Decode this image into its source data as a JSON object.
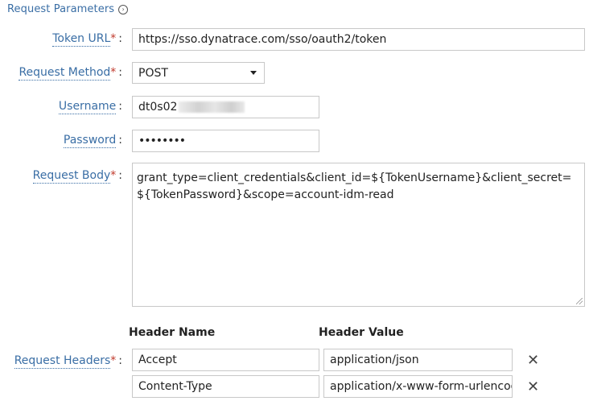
{
  "section": {
    "title": "Request Parameters",
    "info_icon": "info-circle-icon"
  },
  "token_url": {
    "label": "Token URL",
    "value": "https://sso.dynatrace.com/sso/oauth2/token"
  },
  "request_method": {
    "label": "Request Method",
    "value": "POST",
    "icon": "chevron-down-icon"
  },
  "username": {
    "label": "Username",
    "value": "dt0s02"
  },
  "password": {
    "label": "Password",
    "value": "••••••••"
  },
  "request_body": {
    "label": "Request Body",
    "value": "grant_type=client_credentials&client_id=${TokenUsername}&client_secret=${TokenPassword}&scope=account-idm-read"
  },
  "headers": {
    "label": "Request Headers",
    "name_header": "Header Name",
    "value_header": "Header Value",
    "rows": [
      {
        "name": "Accept",
        "value": "application/json"
      },
      {
        "name": "Content-Type",
        "value": "application/x-www-form-urlencoded"
      }
    ],
    "remove_icon": "close-icon",
    "remove_glyph": "✕"
  },
  "required_mark": "*",
  "colon": ":"
}
